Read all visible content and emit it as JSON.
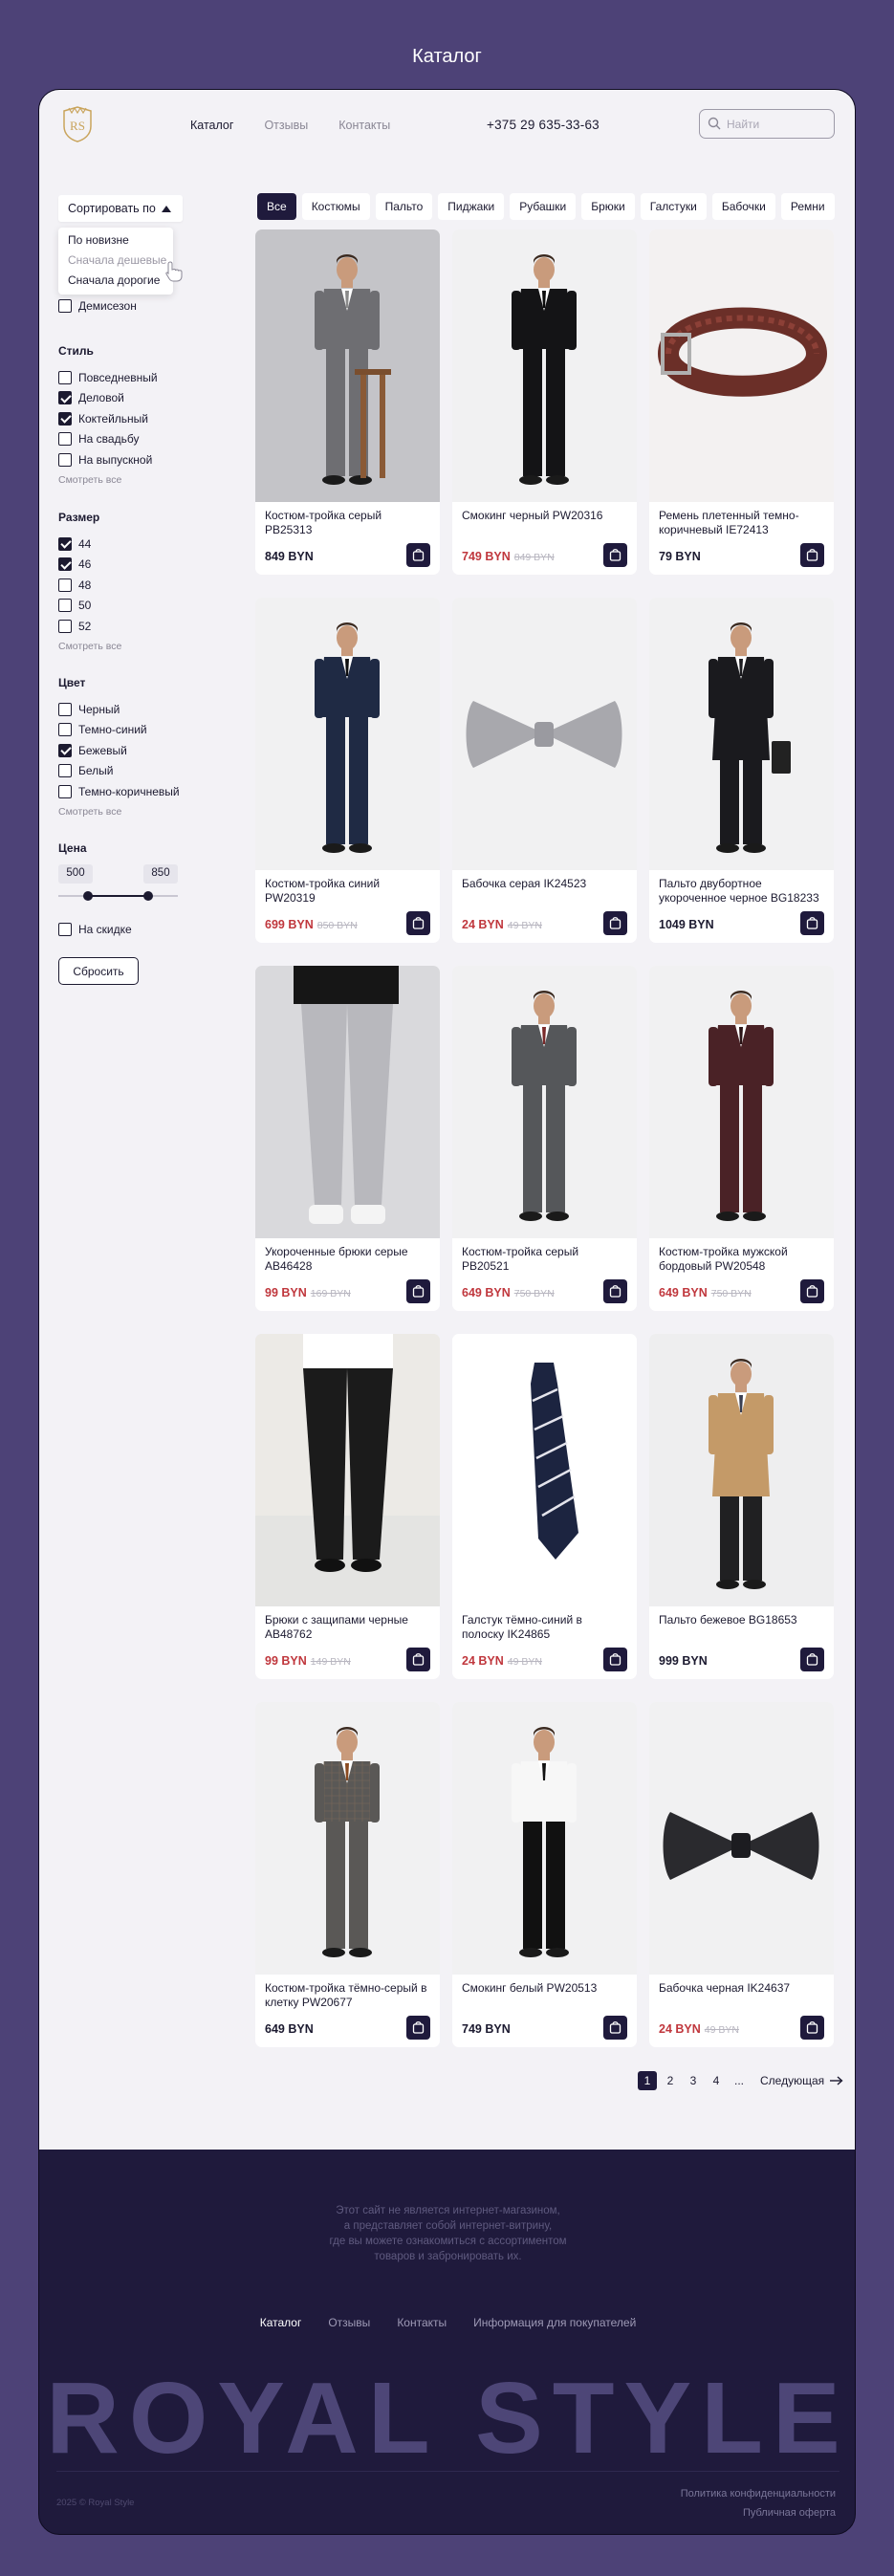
{
  "page_title": "Каталог",
  "header": {
    "nav": [
      "Каталог",
      "Отзывы",
      "Контакты"
    ],
    "phone": "+375 29 635-33-63",
    "search_placeholder": "Найти"
  },
  "sort": {
    "label": "Сортировать по",
    "options": [
      "По новизне",
      "Сначала дешевые",
      "Сначала дорогие"
    ]
  },
  "filters": {
    "season_last": "Демисезон",
    "style": {
      "title": "Стиль",
      "items": [
        {
          "label": "Повседневный",
          "checked": false
        },
        {
          "label": "Деловой",
          "checked": true
        },
        {
          "label": "Коктейльный",
          "checked": true
        },
        {
          "label": "На свадьбу",
          "checked": false
        },
        {
          "label": "На выпускной",
          "checked": false
        }
      ]
    },
    "size": {
      "title": "Размер",
      "items": [
        {
          "label": "44",
          "checked": true
        },
        {
          "label": "46",
          "checked": true
        },
        {
          "label": "48",
          "checked": false
        },
        {
          "label": "50",
          "checked": false
        },
        {
          "label": "52",
          "checked": false
        }
      ]
    },
    "color": {
      "title": "Цвет",
      "items": [
        {
          "label": "Черный",
          "checked": false
        },
        {
          "label": "Темно-синий",
          "checked": false
        },
        {
          "label": "Бежевый",
          "checked": true
        },
        {
          "label": "Белый",
          "checked": false
        },
        {
          "label": "Темно-коричневый",
          "checked": false
        }
      ]
    },
    "see_all": "Смотреть все",
    "price": {
      "title": "Цена",
      "min": "500",
      "max": "850",
      "range_low": 0.25,
      "range_high": 0.75
    },
    "discount": "На скидке",
    "reset": "Сбросить"
  },
  "categories": [
    "Все",
    "Костюмы",
    "Пальто",
    "Пиджаки",
    "Рубашки",
    "Брюки",
    "Галстуки",
    "Бабочки",
    "Ремни"
  ],
  "products": [
    {
      "name": "Костюм-тройка серый PB25313",
      "price": "849 BYN",
      "old": "",
      "img": "suit-grey"
    },
    {
      "name": "Смокинг черный PW20316",
      "price": "749 BYN",
      "old": "849 BYN",
      "img": "tux-black"
    },
    {
      "name": "Ремень плетенный темно-коричневый IE72413",
      "price": "79 BYN",
      "old": "",
      "img": "belt"
    },
    {
      "name": "Костюм-тройка синий PW20319",
      "price": "699 BYN",
      "old": "850 BYN",
      "img": "suit-navy"
    },
    {
      "name": "Бабочка серая IK24523",
      "price": "24 BYN",
      "old": "49 BYN",
      "img": "bow-grey"
    },
    {
      "name": "Пальто двубортное укороченное черное BG18233",
      "price": "1049 BYN",
      "old": "",
      "img": "coat-black"
    },
    {
      "name": "Укороченные брюки серые AB46428",
      "price": "99 BYN",
      "old": "169 BYN",
      "img": "trousers-grey"
    },
    {
      "name": "Костюм-тройка серый PB20521",
      "price": "649 BYN",
      "old": "750 BYN",
      "img": "suit-grey2"
    },
    {
      "name": "Костюм-тройка мужской бордовый PW20548",
      "price": "649 BYN",
      "old": "750 BYN",
      "img": "suit-burgundy"
    },
    {
      "name": "Брюки с защипами черные AB48762",
      "price": "99 BYN",
      "old": "149 BYN",
      "img": "trousers-black"
    },
    {
      "name": "Галстук тёмно-синий в полоску IK24865",
      "price": "24 BYN",
      "old": "49 BYN",
      "img": "tie"
    },
    {
      "name": "Пальто бежевое BG18653",
      "price": "999 BYN",
      "old": "",
      "img": "coat-beige"
    },
    {
      "name": "Костюм-тройка тёмно-серый в клетку PW20677",
      "price": "649 BYN",
      "old": "",
      "img": "suit-check"
    },
    {
      "name": "Смокинг белый PW20513",
      "price": "749 BYN",
      "old": "",
      "img": "tux-white"
    },
    {
      "name": "Бабочка черная IK24637",
      "price": "24 BYN",
      "old": "49 BYN",
      "img": "bow-black"
    }
  ],
  "pagination": {
    "pages": [
      "1",
      "2",
      "3",
      "4"
    ],
    "ellipsis": "...",
    "next": "Следующая",
    "current": "1"
  },
  "footer": {
    "disclaimer": [
      "Этот сайт не является интернет-магазином,",
      "а представляет собой интернет-витрину,",
      "где вы можете ознакомиться с ассортиментом",
      "товаров и забронировать их."
    ],
    "nav": [
      "Каталог",
      "Отзывы",
      "Контакты",
      "Информация для покупателей"
    ],
    "brand": "ROYAL STYLE",
    "copyright": "2025 © Royal Style",
    "legal": [
      "Политика конфиденциальности",
      "Публичная оферта"
    ]
  },
  "colors": {
    "accent": "#1f1a3c",
    "background": "#4d4277",
    "sale": "#c0373d"
  }
}
